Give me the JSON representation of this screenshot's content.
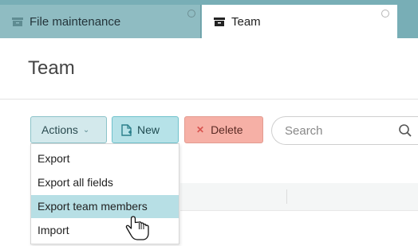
{
  "tabs": [
    {
      "label": "File maintenance",
      "active": false
    },
    {
      "label": "Team",
      "active": true
    }
  ],
  "page": {
    "title": "Team"
  },
  "toolbar": {
    "actions_label": "Actions",
    "new_label": "New",
    "delete_label": "Delete",
    "search_placeholder": "Search"
  },
  "actions_menu": {
    "items": [
      "Export",
      "Export all fields",
      "Export team members",
      "Import"
    ],
    "highlighted_index": 2
  },
  "colors": {
    "tabbar": "#78aeb6",
    "menu_highlight": "#b7dfe5",
    "new_button": "#b6e2e8",
    "delete_button": "#f6b0a6"
  },
  "icons": [
    "archive-box-icon",
    "tab-close-icon",
    "chevron-down-icon",
    "new-document-icon",
    "close-x-icon",
    "search-icon",
    "hand-pointer-cursor-icon"
  ]
}
